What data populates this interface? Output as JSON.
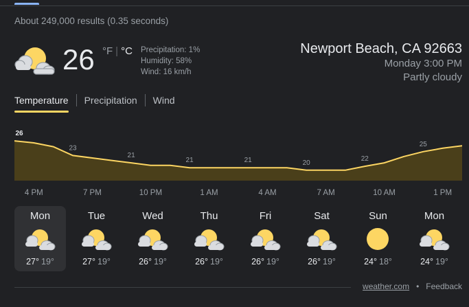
{
  "search": {
    "result_stats": "About 249,000 results (0.35 seconds)"
  },
  "current": {
    "icon": "partly-cloudy-icon",
    "temperature": "26",
    "unit_f": "°F",
    "unit_c": "°C",
    "precipitation": "Precipitation: 1%",
    "humidity": "Humidity: 58%",
    "wind": "Wind: 16 km/h"
  },
  "location": {
    "name": "Newport Beach, CA 92663",
    "datetime": "Monday 3:00 PM",
    "condition": "Partly cloudy"
  },
  "tabs": [
    {
      "label": "Temperature",
      "active": true
    },
    {
      "label": "Precipitation",
      "active": false
    },
    {
      "label": "Wind",
      "active": false
    }
  ],
  "chart_data": {
    "type": "area",
    "x": [
      "3 PM",
      "4 PM",
      "5 PM",
      "6 PM",
      "7 PM",
      "8 PM",
      "9 PM",
      "10 PM",
      "11 PM",
      "12 AM",
      "1 AM",
      "2 AM",
      "3 AM",
      "4 AM",
      "5 AM",
      "6 AM",
      "7 AM",
      "8 AM",
      "9 AM",
      "10 AM",
      "11 AM",
      "12 PM",
      "1 PM",
      "2 PM"
    ],
    "values": [
      26,
      25.6,
      24.8,
      23,
      22.5,
      22,
      21.5,
      21,
      21,
      20.5,
      20.5,
      20.5,
      20.5,
      20.5,
      20.5,
      20,
      20,
      20,
      20.8,
      21.5,
      22.8,
      23.8,
      24.5,
      25
    ],
    "labels": [
      "26",
      "23",
      "21",
      "21",
      "21",
      "20",
      "22",
      "25"
    ],
    "label_index": [
      0,
      3,
      6,
      9,
      12,
      15,
      18,
      21
    ],
    "x_tick_labels": [
      "4 PM",
      "7 PM",
      "10 PM",
      "1 AM",
      "4 AM",
      "7 AM",
      "10 AM",
      "1 PM"
    ],
    "x_tick_index": [
      1,
      4,
      7,
      10,
      13,
      16,
      19,
      22
    ],
    "ylim": [
      18,
      27
    ],
    "colors": {
      "line": "#fdd663",
      "fill": "#4a3f1a"
    }
  },
  "forecast": [
    {
      "day": "Mon",
      "icon": "partly-cloudy-icon",
      "high": "27°",
      "low": "19°",
      "selected": true
    },
    {
      "day": "Tue",
      "icon": "partly-cloudy-icon",
      "high": "27°",
      "low": "19°",
      "selected": false
    },
    {
      "day": "Wed",
      "icon": "partly-cloudy-icon",
      "high": "26°",
      "low": "19°",
      "selected": false
    },
    {
      "day": "Thu",
      "icon": "partly-cloudy-icon",
      "high": "26°",
      "low": "19°",
      "selected": false
    },
    {
      "day": "Fri",
      "icon": "partly-cloudy-icon",
      "high": "26°",
      "low": "19°",
      "selected": false
    },
    {
      "day": "Sat",
      "icon": "partly-cloudy-icon",
      "high": "26°",
      "low": "19°",
      "selected": false
    },
    {
      "day": "Sun",
      "icon": "sunny-icon",
      "high": "24°",
      "low": "18°",
      "selected": false
    },
    {
      "day": "Mon",
      "icon": "partly-cloudy-icon",
      "high": "24°",
      "low": "19°",
      "selected": false
    }
  ],
  "footer": {
    "source": "weather.com",
    "separator": "•",
    "feedback": "Feedback"
  },
  "colors": {
    "accent_tab": "#fdd663",
    "link_blue": "#8ab4f8",
    "background": "#202124"
  }
}
